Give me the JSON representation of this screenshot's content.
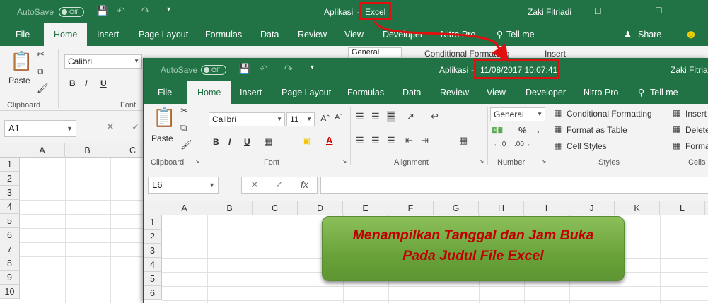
{
  "back_window": {
    "autosave_label": "AutoSave",
    "autosave_state": "Off",
    "title_prefix": "Aplikasi",
    "title_dash": "-",
    "title_app": "Excel",
    "user": "Zaki Fitriadi",
    "tabs": [
      "File",
      "Home",
      "Insert",
      "Page Layout",
      "Formulas",
      "Data",
      "Review",
      "View",
      "Developer",
      "Nitro Pro",
      "Tell me"
    ],
    "share": "Share",
    "paste": "Paste",
    "clipboard": "Clipboard",
    "font_name": "Calibri",
    "font_group": "Font",
    "number_format": "General",
    "conditional": "Conditional Formatting",
    "insert": "Insert",
    "name_box": "A1",
    "columns": [
      "A",
      "B",
      "C"
    ],
    "rows": [
      "1",
      "2",
      "3",
      "4",
      "5",
      "6",
      "7",
      "8",
      "9",
      "10"
    ]
  },
  "front_window": {
    "autosave_label": "AutoSave",
    "autosave_state": "Off",
    "title_prefix": "Aplikasi",
    "title_dash": "-",
    "title_datetime": "11/08/2017 10:07:41",
    "user": "Zaki Fitriad",
    "tabs": [
      "File",
      "Home",
      "Insert",
      "Page Layout",
      "Formulas",
      "Data",
      "Review",
      "View",
      "Developer",
      "Nitro Pro",
      "Tell me"
    ],
    "paste": "Paste",
    "font_name": "Calibri",
    "font_size": "11",
    "number_format": "General",
    "conditional": "Conditional Formatting",
    "format_table": "Format as Table",
    "cell_styles": "Cell Styles",
    "insert": "Insert",
    "delete": "Delete",
    "format": "Format",
    "groups": {
      "clipboard": "Clipboard",
      "font": "Font",
      "alignment": "Alignment",
      "number": "Number",
      "styles": "Styles",
      "cells": "Cells"
    },
    "name_box": "L6",
    "fx": "fx",
    "columns": [
      "A",
      "B",
      "C",
      "D",
      "E",
      "F",
      "G",
      "H",
      "I",
      "J",
      "K",
      "L"
    ],
    "rows": [
      "1",
      "2",
      "3",
      "4",
      "5",
      "6"
    ]
  },
  "annotation": {
    "line1": "Menampilkan Tanggal dan Jam Buka",
    "line2": "Pada Judul File Excel"
  },
  "colors": {
    "excel_green": "#217346",
    "highlight_red": "#e01010",
    "card_green": "#6aa23a",
    "card_text": "#c00000"
  }
}
